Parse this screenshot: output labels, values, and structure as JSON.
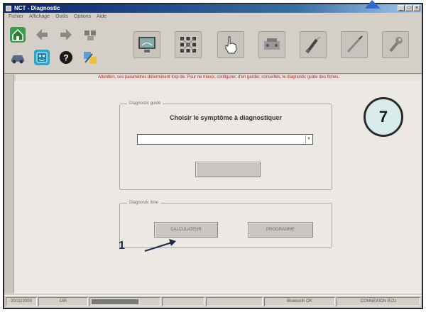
{
  "window": {
    "title": "NCT - Diagnostic"
  },
  "menu": {
    "items": [
      "Fichier",
      "Affichage",
      "Outils",
      "Options",
      "Aide"
    ]
  },
  "toolbar": {
    "small_icons": [
      "home-icon",
      "back-arrow-icon",
      "forward-arrow-icon",
      "stop-icon",
      "car-icon",
      "face-icon",
      "help-icon",
      "tools-icon"
    ],
    "big_icons": [
      "monitor-icon",
      "network-icon",
      "hand-pointer-icon",
      "engine-icon",
      "screwdriver-icon",
      "probe-icon",
      "wrench-icon"
    ]
  },
  "warning": {
    "text": "Attention, ces paramètres déterminent trop de. Pour ne mieux, configurer, d'en garder, conseillés, le diagnostic guide des fiches."
  },
  "guided": {
    "legend": "Diagnostic guidé",
    "title": "Choisir le symptôme à diagnostiquer",
    "combo_value": "",
    "button": ""
  },
  "direct": {
    "legend": "Diagnostic libre",
    "calculator_button": "CALCULATEUR",
    "program_button": "PROGRAMME"
  },
  "badge": {
    "number": "7"
  },
  "callout": {
    "label": "1"
  },
  "status": {
    "cells": [
      "20/11/2009",
      "DIR",
      "",
      "",
      "",
      "Bluetooth OK",
      "CONNEXION ECU"
    ]
  },
  "colors": {
    "warning": "#c21818",
    "titlebar": "#0a246a",
    "badge_fill": "#d8ecec"
  }
}
